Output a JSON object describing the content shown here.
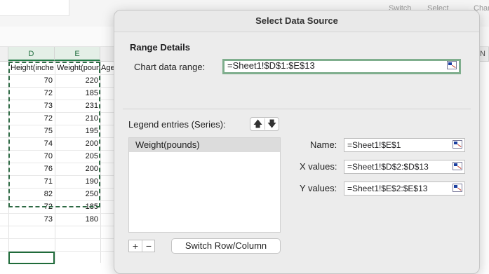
{
  "ribbon": {
    "switch_label": "Switch",
    "select_label": "Select",
    "chart_label": "Char"
  },
  "sheet": {
    "columns": [
      "D",
      "E",
      "N"
    ],
    "headers": [
      "Height(inche",
      "Weight(poun",
      "Age"
    ],
    "rows": [
      [
        "70",
        "220"
      ],
      [
        "72",
        "185"
      ],
      [
        "73",
        "231"
      ],
      [
        "72",
        "210"
      ],
      [
        "75",
        "195"
      ],
      [
        "74",
        "200"
      ],
      [
        "70",
        "205"
      ],
      [
        "76",
        "200"
      ],
      [
        "71",
        "190"
      ],
      [
        "82",
        "250"
      ],
      [
        "72",
        "185"
      ],
      [
        "73",
        "180"
      ]
    ]
  },
  "dialog": {
    "title": "Select Data Source",
    "range_details_title": "Range Details",
    "chart_range_label": "Chart data range:",
    "chart_range_value": "=Sheet1!$D$1:$E$13",
    "legend_label": "Legend entries (Series):",
    "series": [
      "Weight(pounds)"
    ],
    "name_label": "Name:",
    "name_value": "=Sheet1!$E$1",
    "x_label": "X values:",
    "x_value": "=Sheet1!$D$2:$D$13",
    "y_label": "Y values:",
    "y_value": "=Sheet1!$E$2:$E$13",
    "plus_label": "+",
    "minus_label": "−",
    "switch_label": "Switch Row/Column",
    "up_arrow": "🡅",
    "down_arrow": "🡇"
  },
  "colors": {
    "selection_green": "#2e6a44",
    "focus_ring": "#7fae8d"
  }
}
